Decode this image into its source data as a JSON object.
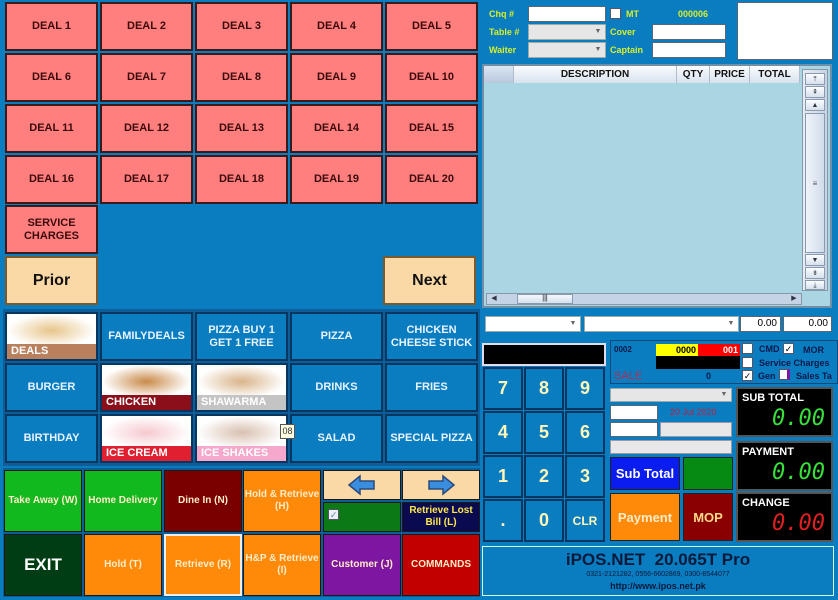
{
  "deals": [
    "DEAL 1",
    "DEAL 2",
    "DEAL 3",
    "DEAL 4",
    "DEAL 5",
    "DEAL 6",
    "DEAL 7",
    "DEAL 8",
    "DEAL 9",
    "DEAL 10",
    "DEAL 11",
    "DEAL 12",
    "DEAL 13",
    "DEAL 14",
    "DEAL 15",
    "DEAL 16",
    "DEAL 17",
    "DEAL 18",
    "DEAL 19",
    "DEAL 20"
  ],
  "service_charges": "SERVICE CHARGES",
  "nav": {
    "prior": "Prior",
    "next": "Next"
  },
  "categories": [
    {
      "label": "DEALS",
      "image": true,
      "cap_color": "#b9805e"
    },
    {
      "label": "FAMILYDEALS",
      "image": false
    },
    {
      "label": "PIZZA BUY 1 GET 1 FREE",
      "image": false
    },
    {
      "label": "PIZZA",
      "image": false
    },
    {
      "label": "CHICKEN CHEESE STICK",
      "image": false
    },
    {
      "label": "BURGER",
      "image": false
    },
    {
      "label": "CHICKEN",
      "image": true,
      "cap_color": "#8a0f1a"
    },
    {
      "label": "SHAWARMA",
      "image": true,
      "cap_color": "#c4c4c4"
    },
    {
      "label": "DRINKS",
      "image": false
    },
    {
      "label": "FRIES",
      "image": false
    },
    {
      "label": "BIRTHDAY",
      "image": false
    },
    {
      "label": "ICE CREAM",
      "image": true,
      "cap_color": "#e02030"
    },
    {
      "label": "ICE SHAKES",
      "image": true,
      "cap_color": "#f5a7cc"
    },
    {
      "label": "SALAD",
      "image": false
    },
    {
      "label": "SPECIAL PIZZA",
      "image": false
    }
  ],
  "tooltip": "08",
  "actions": {
    "take_away": "Take Away (W)",
    "home_delivery": "Home Delivery",
    "dine_in": "Dine In (N)",
    "hold_retrieve": "Hold & Retrieve (H)",
    "retrieve_lost": "Retrieve Lost Bill (L)",
    "exit": "EXIT",
    "hold": "Hold (T)",
    "retrieve": "Retrieve (R)",
    "hp_retrieve": "H&P & Retrieve (I)",
    "customer": "Customer (J)",
    "commands": "COMMANDS"
  },
  "order": {
    "chq_label": "Chq #",
    "table_label": "Table #",
    "waiter_label": "Waiter",
    "mt_label": "MT",
    "order_no": "000006",
    "cover_label": "Cover",
    "captain_label": "Captain"
  },
  "grid": {
    "columns": [
      "DESCRIPTION",
      "QTY",
      "PRICE",
      "TOTAL"
    ]
  },
  "entry": {
    "val1": "0.00",
    "val2": "0.00"
  },
  "status": {
    "code": "0002",
    "yellow_val": "0000",
    "red_val": "001",
    "sale_label": "SALE",
    "sale_count": "0",
    "cmd_label": "CMD",
    "mor_label": "MOR",
    "service_charges_label": "Service Charges",
    "gen_label": "Gen",
    "sales_tax_label": "Sales Ta",
    "cmd_checked": false,
    "mor_checked": true,
    "service_checked": false,
    "gen_checked": true
  },
  "date": "20 Jul 2020",
  "numpad": [
    "7",
    "8",
    "9",
    "4",
    "5",
    "6",
    "1",
    "2",
    "3",
    ".",
    "0",
    "CLR"
  ],
  "buttons": {
    "subtotal": "Sub Total",
    "payment": "Payment",
    "mop": "MOP"
  },
  "totals": {
    "subtotal_label": "SUB TOTAL",
    "subtotal": "0.00",
    "payment_label": "PAYMENT",
    "payment": "0.00",
    "change_label": "CHANGE",
    "change": "0.00"
  },
  "footer": {
    "title": "iPOS.NET  20.065T Pro",
    "phones": "0321-2121282, 0556-6602869, 0300-8544077",
    "url": "http://www.ipos.net.pk"
  }
}
